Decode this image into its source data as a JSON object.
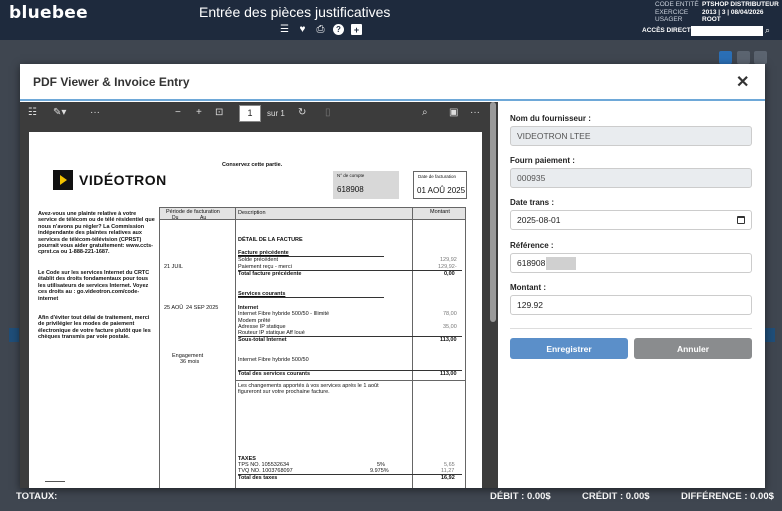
{
  "app": {
    "logo": "bluebee",
    "title": "Entrée des pièces justificatives",
    "meta": [
      {
        "key": "CODE ENTITÉ",
        "value": "PTSHOP DISTRIBUTEUR"
      },
      {
        "key": "EXERCICE",
        "value": "2013 | 3 | 08/04/2026"
      },
      {
        "key": "USAGER",
        "value": "ROOT"
      }
    ],
    "acces_direct_label": "ACCÈS DIRECT",
    "acces_direct_value": ""
  },
  "footer": {
    "totaux": "TOTAUX:",
    "debit": "DÉBIT : 0.00$",
    "credit": "CRÉDIT : 0.00$",
    "difference": "DIFFÉRENCE : 0.00$"
  },
  "modal": {
    "title": "PDF Viewer & Invoice Entry",
    "close": "✕"
  },
  "pdf_toolbar": {
    "page_current": "1",
    "page_of": "sur 1"
  },
  "invoice": {
    "keep_notice": "Conservez cette partie.",
    "brand": "VIDÉOTRON",
    "account_label": "N° de compte",
    "account_number": "618908",
    "date_label": "Date de facturation",
    "date_value": "01 AOÛ 2025",
    "left_blurb_1": "Avez-vous une plainte relative à votre service de télécom ou de télé résidentiel que nous n'avons pu régler? La Commission indépendante des plaintes relatives aux services de télécom-télévision (CPRST) pourrait vous aider gratuitement: www.ccts-cprst.ca ou 1-888-221-1687.",
    "left_blurb_2": "Le Code sur les services Internet du CRTC établit des droits fondamentaux pour tous les utilisateurs de services Internet. Voyez ces droits au : go.videotron.com/code-internet",
    "left_blurb_3": "Afin d'éviter tout délai de traitement, merci de privilégier les modes de paiement électronique de votre facture plutôt que les chèques transmis par voie postale.",
    "col_period": "Période de facturation",
    "col_du": "Du",
    "col_au": "Au",
    "col_desc": "Description",
    "col_amount": "Montant",
    "detail_title": "DÉTAIL DE LA FACTURE",
    "prev_title": "Facture précédente",
    "prev_date": "21 JUIL",
    "prev_lines": [
      {
        "desc": "Solde précédent",
        "amount": "129,92"
      },
      {
        "desc": "Paiement reçu - merci",
        "amount": "129,92-"
      }
    ],
    "prev_total_label": "Total facture précédente",
    "prev_total": "0,00",
    "current_title": "Services courants",
    "period_du": "25 AOÛ",
    "period_au": "24 SEP 2025",
    "internet_label": "Internet",
    "internet_lines": [
      {
        "desc": "Internet Fibre hybride 500/50 - Illimité",
        "amount": "78,00"
      },
      {
        "desc": "Modem prêté",
        "amount": ""
      },
      {
        "desc": "Adresse IP statique",
        "amount": "35,00"
      },
      {
        "desc": "Routeur IP statique Aff loué",
        "amount": ""
      }
    ],
    "subtotal_label": "Sous-total Internet",
    "subtotal": "113,00",
    "engagement": "Engagement",
    "engagement_months": "36 mois",
    "engagement_desc": "Internet Fibre hybride 500/50",
    "current_total_label": "Total des services courants",
    "current_total": "113,00",
    "changes_note": "Les changements apportés à vos services après le 1 août figureront sur votre prochaine facture.",
    "taxes_label": "TAXES",
    "taxes": [
      {
        "desc": "TPS NO. 105532634",
        "rate": "5%",
        "amount": "5,65"
      },
      {
        "desc": "TVQ NO. 1003768097",
        "rate": "9.975%",
        "amount": "11,27"
      }
    ],
    "taxes_total_label": "Total des taxes",
    "taxes_total": "16,92"
  },
  "form": {
    "supplier_label": "Nom du fournisseur :",
    "supplier_value": "VIDEOTRON LTEE",
    "fourn_label": "Fourn paiement :",
    "fourn_value": "000935",
    "date_label": "Date trans :",
    "date_value": "2025-08-01",
    "ref_label": "Référence :",
    "ref_value": "618908",
    "amount_label": "Montant :",
    "amount_value": "129.92",
    "save_label": "Enregistrer",
    "cancel_label": "Annuler"
  }
}
